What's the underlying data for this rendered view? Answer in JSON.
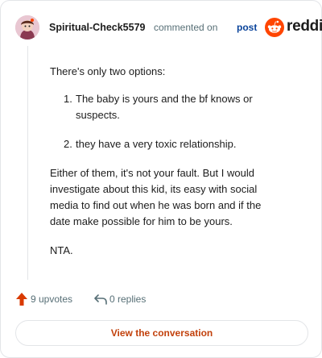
{
  "header": {
    "author": "Spiritual-Check5579",
    "action_text": "commented on",
    "post_link": "post",
    "brand": "reddit"
  },
  "comment": {
    "intro": "There's only two options:",
    "list": [
      {
        "num": "1.",
        "lines": [
          "The baby is yours and the bf knows or",
          "suspects."
        ]
      },
      {
        "num": "2.",
        "lines": [
          "they have a very toxic relationship."
        ]
      }
    ],
    "paragraph_lines": [
      "Either of them, it's not your fault. But I would",
      "investigate about this kid, its easy with social",
      "media to find out when he was born and if the",
      "date make possible for him to be yours."
    ],
    "closing": "NTA."
  },
  "footer": {
    "upvotes": "9 upvotes",
    "replies": "0 replies"
  },
  "cta": {
    "label": "View the conversation"
  },
  "colors": {
    "brand_orange": "#ff4500",
    "upvote": "#d93a00",
    "link_blue": "#0a449b",
    "cta_text": "#c2410c",
    "muted": "#576f76",
    "border": "#e3e5e8"
  },
  "icons": {
    "avatar": "snoo-avatar",
    "brand": "reddit-logo-icon",
    "upvote": "upvote-arrow-icon",
    "reply": "reply-arrow-icon"
  }
}
